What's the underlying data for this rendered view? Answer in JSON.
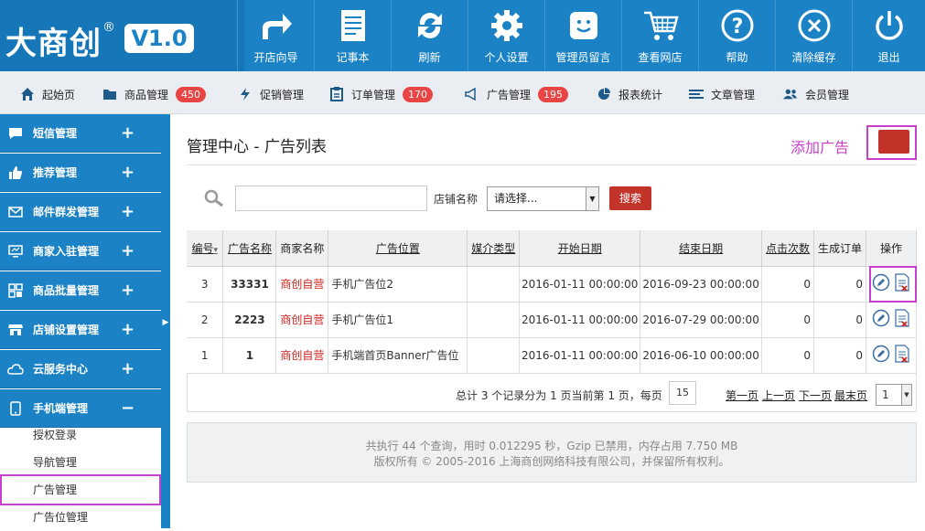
{
  "logo": {
    "text": "大商创",
    "reg": "®",
    "version": "V1.0"
  },
  "top_buttons": [
    {
      "label": "开店向导",
      "icon": "share-arrow-icon"
    },
    {
      "label": "记事本",
      "icon": "notepad-icon"
    },
    {
      "label": "刷新",
      "icon": "refresh-icon"
    },
    {
      "label": "个人设置",
      "icon": "gear-icon"
    },
    {
      "label": "管理员留言",
      "icon": "message-icon"
    },
    {
      "label": "查看网店",
      "icon": "cart-icon"
    },
    {
      "label": "帮助",
      "icon": "help-icon"
    },
    {
      "label": "清除缓存",
      "icon": "close-circle-icon"
    },
    {
      "label": "退出",
      "icon": "power-icon"
    }
  ],
  "nav": [
    {
      "label": "起始页",
      "icon": "home-icon"
    },
    {
      "label": "商品管理",
      "icon": "folder-icon",
      "badge": "450"
    },
    {
      "label": "促销管理",
      "icon": "flash-icon"
    },
    {
      "label": "订单管理",
      "icon": "clipboard-icon",
      "badge": "170"
    },
    {
      "label": "广告管理",
      "icon": "megaphone-icon",
      "badge": "195"
    },
    {
      "label": "报表统计",
      "icon": "pie-chart-icon"
    },
    {
      "label": "文章管理",
      "icon": "list-icon"
    },
    {
      "label": "会员管理",
      "icon": "users-icon"
    }
  ],
  "sidebar": {
    "groups": [
      {
        "label": "短信管理",
        "icon": "chat-icon",
        "toggle": "+"
      },
      {
        "label": "推荐管理",
        "icon": "thumbs-up-icon",
        "toggle": "+"
      },
      {
        "label": "邮件群发管理",
        "icon": "mail-icon",
        "toggle": "+"
      },
      {
        "label": "商家入驻管理",
        "icon": "monitor-icon",
        "toggle": "+"
      },
      {
        "label": "商品批量管理",
        "icon": "grid-icon",
        "toggle": "+"
      },
      {
        "label": "店铺设置管理",
        "icon": "store-icon",
        "toggle": "+"
      },
      {
        "label": "云服务中心",
        "icon": "cloud-icon",
        "toggle": "+"
      },
      {
        "label": "手机端管理",
        "icon": "mobile-icon",
        "toggle": "−"
      }
    ],
    "subitems": [
      "授权登录",
      "导航管理",
      "广告管理",
      "广告位管理"
    ]
  },
  "main": {
    "title": "管理中心 - 广告列表",
    "add_link": "添加广告",
    "search": {
      "input_value": "",
      "shop_label": "店铺名称",
      "shop_select": "请选择...",
      "button": "搜索"
    }
  },
  "table": {
    "headers": [
      "编号",
      "广告名称",
      "商家名称",
      "广告位置",
      "媒介类型",
      "开始日期",
      "结束日期",
      "点击次数",
      "生成订单",
      "操作"
    ],
    "sort_indicator": "▾",
    "rows": [
      {
        "id": "3",
        "name": "33331",
        "merchant": "商创自营",
        "position": "手机广告位2",
        "media": "",
        "start": "2016-01-11 00:00:00",
        "end": "2016-09-23 00:00:00",
        "clicks": "0",
        "orders": "0"
      },
      {
        "id": "2",
        "name": "2223",
        "merchant": "商创自营",
        "position": "手机广告位1",
        "media": "",
        "start": "2016-01-11 00:00:00",
        "end": "2016-07-29 00:00:00",
        "clicks": "0",
        "orders": "0"
      },
      {
        "id": "1",
        "name": "1",
        "merchant": "商创自营",
        "position": "手机端首页Banner广告位",
        "media": "",
        "start": "2016-01-11 00:00:00",
        "end": "2016-06-10 00:00:00",
        "clicks": "0",
        "orders": "0"
      }
    ]
  },
  "pager": {
    "summary": "总计 3 个记录分为 1 页当前第 1 页，每页",
    "page_size": "15",
    "first": "第一页",
    "prev": "上一页",
    "next": "下一页",
    "last": "最末页",
    "page_select": "1"
  },
  "footer": {
    "line1": "共执行 44 个查询，用时 0.012295 秒，Gzip 已禁用，内存占用 7.750 MB",
    "line2": "版权所有 © 2005-2016 上海商创网络科技有限公司，并保留所有权利。"
  },
  "colors": {
    "primary": "#1b83c5",
    "highlight": "#c93fcd",
    "danger": "#c2332a",
    "badge": "#e94545"
  }
}
